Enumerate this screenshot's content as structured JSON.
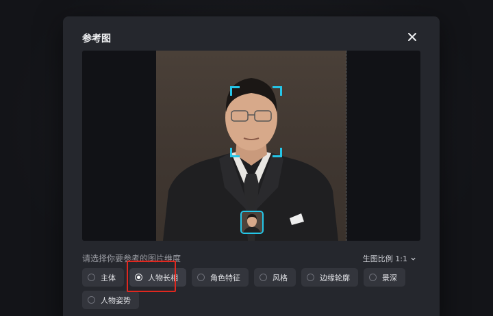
{
  "dialog": {
    "title": "参考图",
    "close_icon": "close-icon"
  },
  "preview": {
    "face_frame_color": "#25c6e8"
  },
  "dimension": {
    "label": "请选择你要参考的图片维度",
    "ratio_label": "生图比例 1:1",
    "ratio_icon": "chevron-down-icon"
  },
  "options": [
    {
      "label": "主体",
      "selected": false
    },
    {
      "label": "人物长相",
      "selected": true
    },
    {
      "label": "角色特征",
      "selected": false
    },
    {
      "label": "风格",
      "selected": false
    },
    {
      "label": "边缘轮廓",
      "selected": false
    },
    {
      "label": "景深",
      "selected": false
    },
    {
      "label": "人物姿势",
      "selected": false
    }
  ],
  "colors": {
    "accent": "#25c6e8",
    "highlight": "#e0281f",
    "modal_bg": "#25272d"
  }
}
